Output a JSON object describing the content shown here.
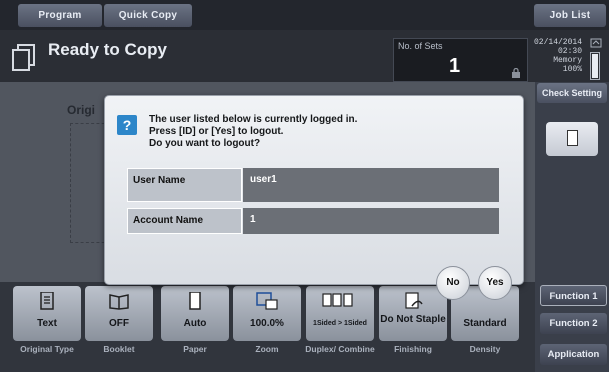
{
  "tabs": {
    "program": "Program",
    "quick_copy": "Quick Copy",
    "job_list": "Job List"
  },
  "status": {
    "title": "Ready to Copy",
    "sets_label": "No. of Sets",
    "sets_value": "1",
    "date": "02/14/2014",
    "time": "02:30",
    "memory_label": "Memory",
    "memory_value": "100%"
  },
  "check_setting": "Check Setting",
  "background": {
    "original_label": "Origi"
  },
  "tiles": [
    {
      "value": "Text",
      "name": "Original Type",
      "icon": "text-doc-icon"
    },
    {
      "value": "OFF",
      "name": "Booklet",
      "icon": "booklet-icon"
    },
    {
      "value": "Auto",
      "name": "Paper",
      "icon": "paper-icon"
    },
    {
      "value": "100.0%",
      "name": "Zoom",
      "icon": "zoom-icon"
    },
    {
      "value": "1Sided > 1Sided",
      "name": "Duplex/ Combine",
      "icon": "duplex-icon"
    },
    {
      "value": "Do Not Staple",
      "name": "Finishing",
      "icon": "staple-icon"
    },
    {
      "value": "Standard",
      "name": "Density",
      "icon": "density-icon"
    }
  ],
  "function_buttons": {
    "f1": "Function 1",
    "f2": "Function 2",
    "app": "Application"
  },
  "dialog": {
    "line1": "The user listed below is currently logged in.",
    "line2": "Press [ID] or [Yes] to logout.",
    "line3": "Do you want to logout?",
    "user_name_label": "User Name",
    "user_name_value": "user1",
    "account_name_label": "Account Name",
    "account_name_value": "1",
    "no_label": "No",
    "yes_label": "Yes"
  },
  "colors": {
    "dialog_icon": "#2d86c9",
    "value_cell": "#6b6f76",
    "label_cell": "#bdc2ca"
  }
}
